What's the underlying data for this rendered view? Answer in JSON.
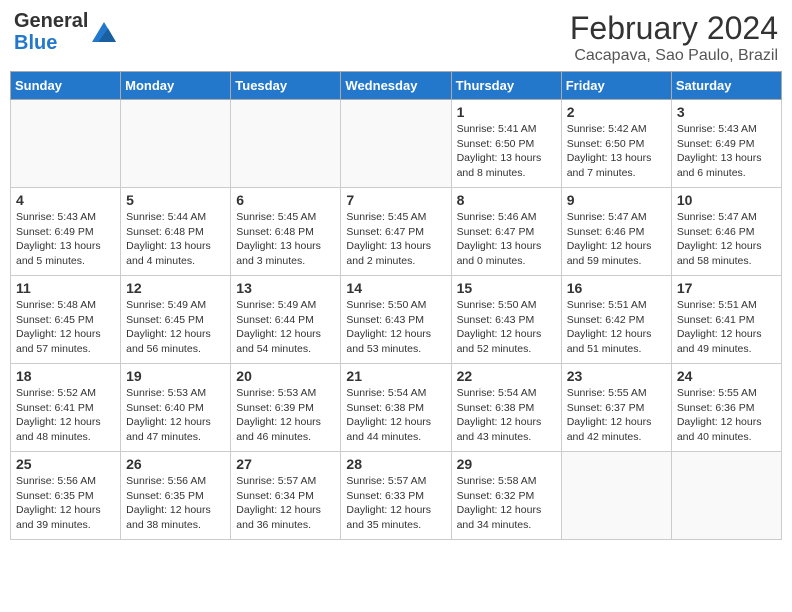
{
  "logo": {
    "general": "General",
    "blue": "Blue"
  },
  "title": "February 2024",
  "location": "Cacapava, Sao Paulo, Brazil",
  "days_of_week": [
    "Sunday",
    "Monday",
    "Tuesday",
    "Wednesday",
    "Thursday",
    "Friday",
    "Saturday"
  ],
  "weeks": [
    [
      {
        "day": "",
        "info": ""
      },
      {
        "day": "",
        "info": ""
      },
      {
        "day": "",
        "info": ""
      },
      {
        "day": "",
        "info": ""
      },
      {
        "day": "1",
        "info": "Sunrise: 5:41 AM\nSunset: 6:50 PM\nDaylight: 13 hours\nand 8 minutes."
      },
      {
        "day": "2",
        "info": "Sunrise: 5:42 AM\nSunset: 6:50 PM\nDaylight: 13 hours\nand 7 minutes."
      },
      {
        "day": "3",
        "info": "Sunrise: 5:43 AM\nSunset: 6:49 PM\nDaylight: 13 hours\nand 6 minutes."
      }
    ],
    [
      {
        "day": "4",
        "info": "Sunrise: 5:43 AM\nSunset: 6:49 PM\nDaylight: 13 hours\nand 5 minutes."
      },
      {
        "day": "5",
        "info": "Sunrise: 5:44 AM\nSunset: 6:48 PM\nDaylight: 13 hours\nand 4 minutes."
      },
      {
        "day": "6",
        "info": "Sunrise: 5:45 AM\nSunset: 6:48 PM\nDaylight: 13 hours\nand 3 minutes."
      },
      {
        "day": "7",
        "info": "Sunrise: 5:45 AM\nSunset: 6:47 PM\nDaylight: 13 hours\nand 2 minutes."
      },
      {
        "day": "8",
        "info": "Sunrise: 5:46 AM\nSunset: 6:47 PM\nDaylight: 13 hours\nand 0 minutes."
      },
      {
        "day": "9",
        "info": "Sunrise: 5:47 AM\nSunset: 6:46 PM\nDaylight: 12 hours\nand 59 minutes."
      },
      {
        "day": "10",
        "info": "Sunrise: 5:47 AM\nSunset: 6:46 PM\nDaylight: 12 hours\nand 58 minutes."
      }
    ],
    [
      {
        "day": "11",
        "info": "Sunrise: 5:48 AM\nSunset: 6:45 PM\nDaylight: 12 hours\nand 57 minutes."
      },
      {
        "day": "12",
        "info": "Sunrise: 5:49 AM\nSunset: 6:45 PM\nDaylight: 12 hours\nand 56 minutes."
      },
      {
        "day": "13",
        "info": "Sunrise: 5:49 AM\nSunset: 6:44 PM\nDaylight: 12 hours\nand 54 minutes."
      },
      {
        "day": "14",
        "info": "Sunrise: 5:50 AM\nSunset: 6:43 PM\nDaylight: 12 hours\nand 53 minutes."
      },
      {
        "day": "15",
        "info": "Sunrise: 5:50 AM\nSunset: 6:43 PM\nDaylight: 12 hours\nand 52 minutes."
      },
      {
        "day": "16",
        "info": "Sunrise: 5:51 AM\nSunset: 6:42 PM\nDaylight: 12 hours\nand 51 minutes."
      },
      {
        "day": "17",
        "info": "Sunrise: 5:51 AM\nSunset: 6:41 PM\nDaylight: 12 hours\nand 49 minutes."
      }
    ],
    [
      {
        "day": "18",
        "info": "Sunrise: 5:52 AM\nSunset: 6:41 PM\nDaylight: 12 hours\nand 48 minutes."
      },
      {
        "day": "19",
        "info": "Sunrise: 5:53 AM\nSunset: 6:40 PM\nDaylight: 12 hours\nand 47 minutes."
      },
      {
        "day": "20",
        "info": "Sunrise: 5:53 AM\nSunset: 6:39 PM\nDaylight: 12 hours\nand 46 minutes."
      },
      {
        "day": "21",
        "info": "Sunrise: 5:54 AM\nSunset: 6:38 PM\nDaylight: 12 hours\nand 44 minutes."
      },
      {
        "day": "22",
        "info": "Sunrise: 5:54 AM\nSunset: 6:38 PM\nDaylight: 12 hours\nand 43 minutes."
      },
      {
        "day": "23",
        "info": "Sunrise: 5:55 AM\nSunset: 6:37 PM\nDaylight: 12 hours\nand 42 minutes."
      },
      {
        "day": "24",
        "info": "Sunrise: 5:55 AM\nSunset: 6:36 PM\nDaylight: 12 hours\nand 40 minutes."
      }
    ],
    [
      {
        "day": "25",
        "info": "Sunrise: 5:56 AM\nSunset: 6:35 PM\nDaylight: 12 hours\nand 39 minutes."
      },
      {
        "day": "26",
        "info": "Sunrise: 5:56 AM\nSunset: 6:35 PM\nDaylight: 12 hours\nand 38 minutes."
      },
      {
        "day": "27",
        "info": "Sunrise: 5:57 AM\nSunset: 6:34 PM\nDaylight: 12 hours\nand 36 minutes."
      },
      {
        "day": "28",
        "info": "Sunrise: 5:57 AM\nSunset: 6:33 PM\nDaylight: 12 hours\nand 35 minutes."
      },
      {
        "day": "29",
        "info": "Sunrise: 5:58 AM\nSunset: 6:32 PM\nDaylight: 12 hours\nand 34 minutes."
      },
      {
        "day": "",
        "info": ""
      },
      {
        "day": "",
        "info": ""
      }
    ]
  ]
}
